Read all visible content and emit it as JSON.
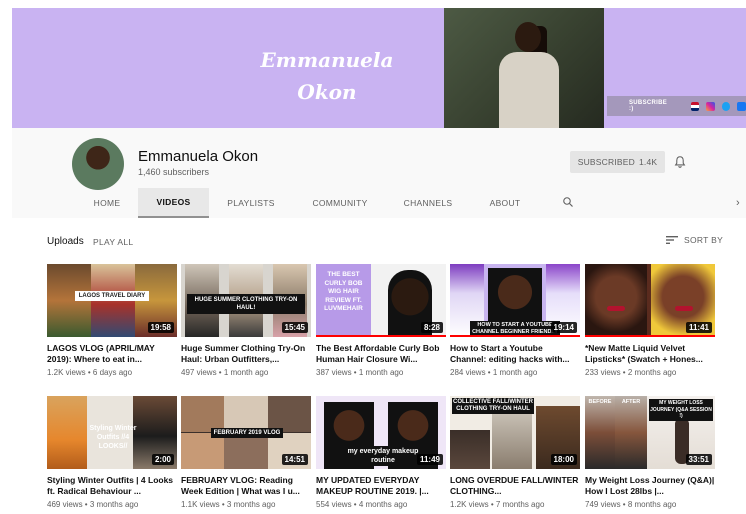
{
  "banner": {
    "name_line1": "Emmanuela",
    "name_line2": "Okon",
    "subscribe_label": "SUBSCRIBE :)"
  },
  "channel": {
    "name": "Emmanuela Okon",
    "subscribers": "1,460 subscribers",
    "subscribed_label": "SUBSCRIBED",
    "subscribed_count": "1.4K"
  },
  "tabs": [
    {
      "label": "HOME"
    },
    {
      "label": "VIDEOS"
    },
    {
      "label": "PLAYLISTS"
    },
    {
      "label": "COMMUNITY"
    },
    {
      "label": "CHANNELS"
    },
    {
      "label": "ABOUT"
    }
  ],
  "uploads": {
    "title": "Uploads",
    "play_all": "PLAY ALL",
    "sort_by": "SORT BY"
  },
  "colors": {
    "banner_bg": "#c9b3f2",
    "progress": "#ff0000"
  },
  "videos": [
    {
      "title": "LAGOS VLOG (APRIL/MAY 2019): Where to eat in...",
      "meta": "1.2K views • 6 days ago",
      "duration": "19:58",
      "caption": "LAGOS TRAVEL DIARY",
      "progress": 0.0
    },
    {
      "title": "Huge Summer Clothing Try-On Haul: Urban Outfitters,...",
      "meta": "497 views • 1 month ago",
      "duration": "15:45",
      "caption": "HUGE SUMMER CLOTHING TRY-ON HAUL!",
      "progress": 0.0
    },
    {
      "title": "The Best Affordable Curly Bob Human Hair Closure Wi...",
      "meta": "387 views • 1 month ago",
      "duration": "8:28",
      "caption": "THE BEST CURLY BOB WIG HAIR REVIEW FT. LUVMEHAIR",
      "progress": 1.0
    },
    {
      "title": "How to Start a Youtube Channel: editing hacks with...",
      "meta": "284 views • 1 month ago",
      "duration": "19:14",
      "caption": "HOW TO START A YOUTUBE CHANNEL BEGINNER FRIENDLY",
      "progress": 1.0
    },
    {
      "title": "*New Matte Liquid Velvet Lipsticks* (Swatch + Hones...",
      "meta": "233 views • 2 months ago",
      "duration": "11:41",
      "caption": "",
      "progress": 1.0
    },
    {
      "title": "Styling Winter Outfits | 4 Looks ft. Radical Behaviour ...",
      "meta": "469 views • 3 months ago",
      "duration": "2:00",
      "caption": "Styling Winter Outfits //4 LOOKS//",
      "progress": 0.0
    },
    {
      "title": "FEBRUARY VLOG: Reading Week Edition | What was I u...",
      "meta": "1.1K views • 3 months ago",
      "duration": "14:51",
      "caption": "FEBRUARY 2019 VLOG",
      "progress": 0.0
    },
    {
      "title": "MY UPDATED EVERYDAY MAKEUP ROUTINE 2019. |...",
      "meta": "554 views • 4 months ago",
      "duration": "11:49",
      "caption": "my everyday makeup routine",
      "progress": 0.0
    },
    {
      "title": "LONG OVERDUE FALL/WINTER CLOTHING...",
      "meta": "1.2K views • 7 months ago",
      "duration": "18:00",
      "caption": "COLLECTIVE FALL/WINTER CLOTHING TRY-ON HAUL",
      "progress": 0.0
    },
    {
      "title": "My Weight Loss Journey (Q&A)| How I Lost 28lbs |...",
      "meta": "749 views • 8 months ago",
      "duration": "33:51",
      "caption": "MY WEIGHT LOSS JOURNEY (Q&A SESSION !)",
      "caption2": "BEFORE",
      "caption3": "AFTER",
      "progress": 0.0
    }
  ]
}
